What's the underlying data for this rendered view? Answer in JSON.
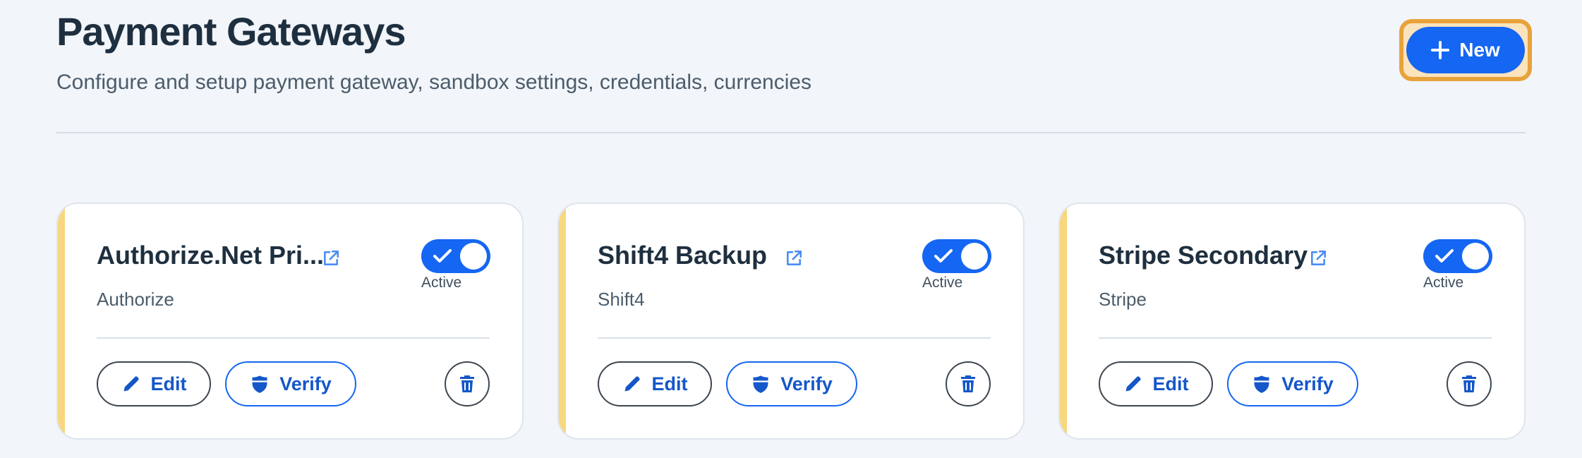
{
  "header": {
    "title": "Payment Gateways",
    "subtitle": "Configure and setup payment gateway, sandbox settings, credentials, currencies",
    "new_button_label": "New"
  },
  "colors": {
    "accent": "#1566f2",
    "card_stripe": "#f8d77e",
    "focus_ring": "#e8a23b"
  },
  "cards": [
    {
      "name": "Authorize.Net Pri...",
      "provider": "Authorize",
      "status": "Active",
      "active": true,
      "edit_label": "Edit",
      "verify_label": "Verify"
    },
    {
      "name": "Shift4 Backup",
      "provider": "Shift4",
      "status": "Active",
      "active": true,
      "edit_label": "Edit",
      "verify_label": "Verify"
    },
    {
      "name": "Stripe Secondary",
      "provider": "Stripe",
      "status": "Active",
      "active": true,
      "edit_label": "Edit",
      "verify_label": "Verify"
    }
  ],
  "icons": {
    "new": "plus-icon",
    "external": "external-link-icon",
    "toggle": "check-icon",
    "edit": "pencil-icon",
    "verify": "shield-icon",
    "delete": "trash-icon"
  }
}
